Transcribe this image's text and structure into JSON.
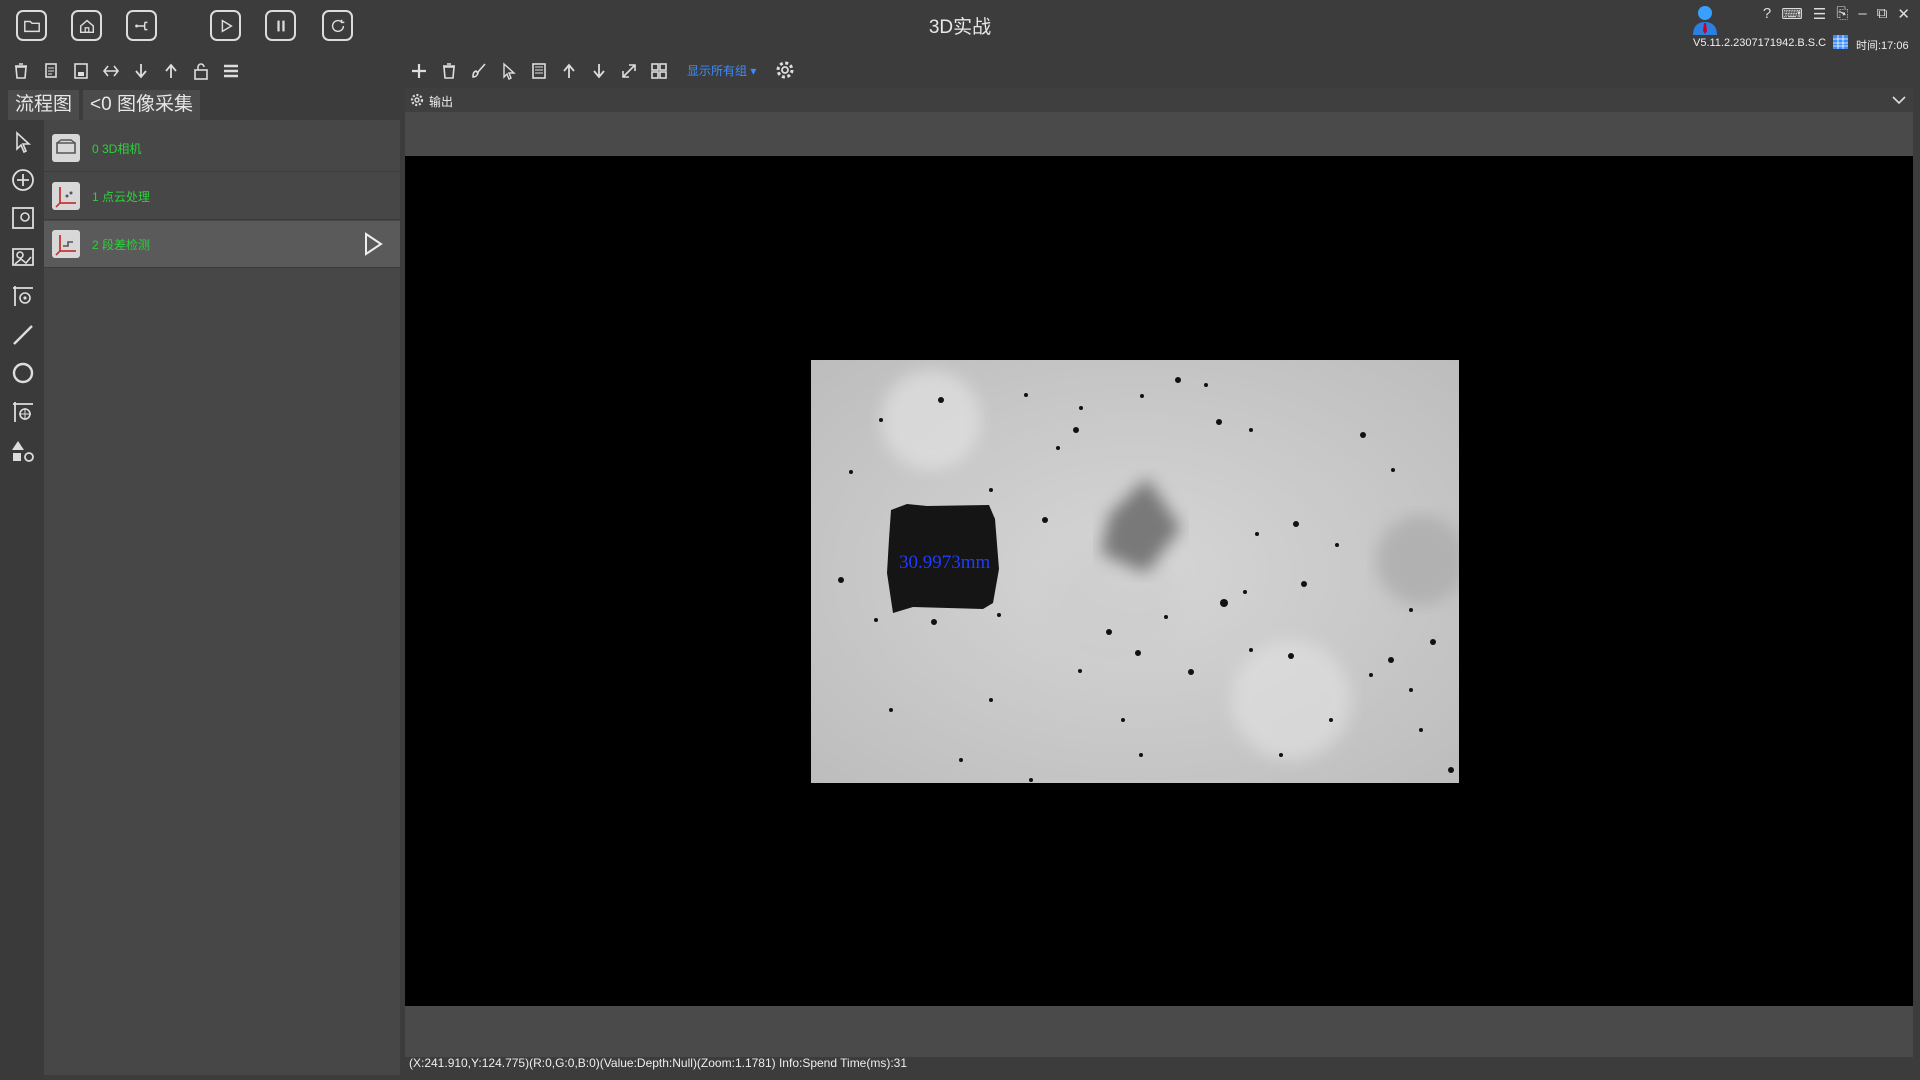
{
  "app": {
    "title": "3D实战",
    "version": "V5.11.2.2307171942.B.S.C",
    "clock": "时间:17:06",
    "help_glyph": "?",
    "min_glyph": "–",
    "restore_glyph": "⧉",
    "close_glyph": "✕"
  },
  "tabs": [
    {
      "label": "流程图"
    },
    {
      "label": "<0  图像采集"
    }
  ],
  "toolbar": {
    "show_all_groups": "显示所有组"
  },
  "flow_nodes": [
    {
      "label": "0  3D相机"
    },
    {
      "label": "1  点云处理"
    },
    {
      "label": "2  段差检测"
    }
  ],
  "output": {
    "label": "输出"
  },
  "image": {
    "measure_text": "30.9973mm"
  },
  "status": {
    "text": "(X:241.910,Y:124.775)(R:0,G:0,B:0)(Value:Depth:Null)(Zoom:1.1781)   Info:Spend Time(ms):31"
  }
}
